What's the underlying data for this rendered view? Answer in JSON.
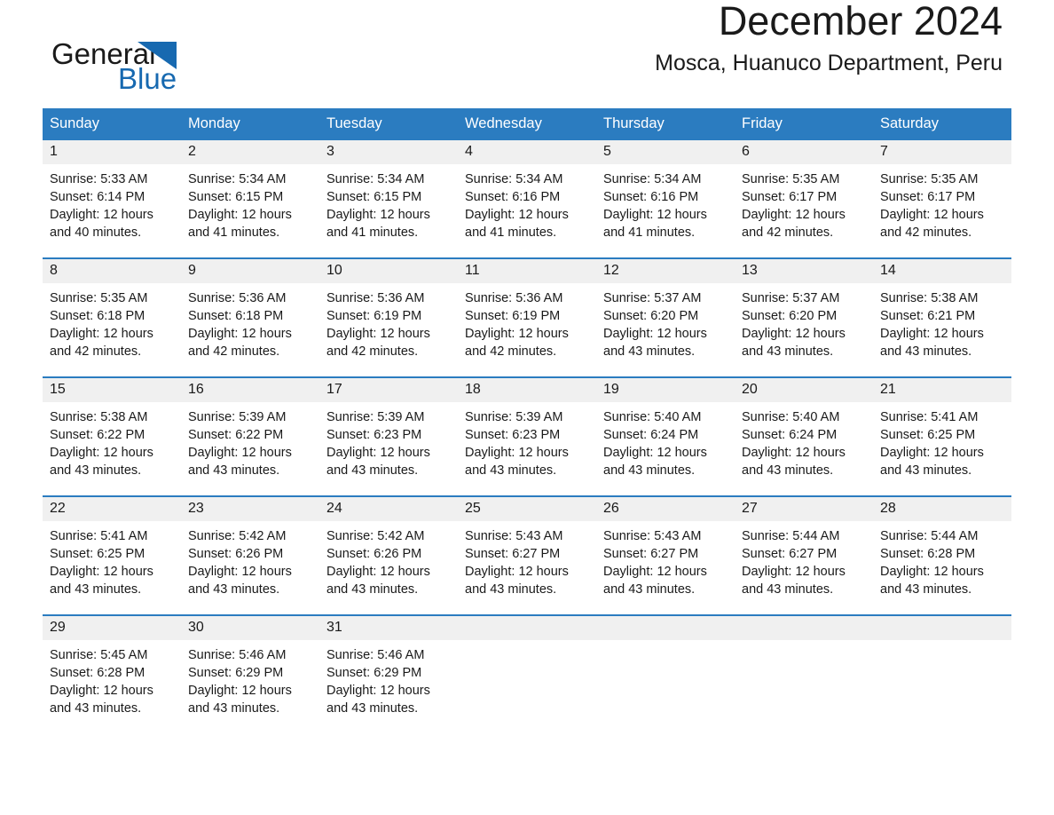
{
  "brand": {
    "name_part1": "General",
    "name_part2": "Blue",
    "triangle_icon": "triangle-logo-icon",
    "accent_color": "#1769b0"
  },
  "header": {
    "title": "December 2024",
    "subtitle": "Mosca, Huanuco Department, Peru"
  },
  "theme": {
    "header_blue": "#2b7cc0",
    "daynum_band": "#f0f0f0",
    "text": "#1a1a1a"
  },
  "weekday_headers": [
    "Sunday",
    "Monday",
    "Tuesday",
    "Wednesday",
    "Thursday",
    "Friday",
    "Saturday"
  ],
  "weeks": [
    [
      {
        "day": "1",
        "sunrise": "Sunrise: 5:33 AM",
        "sunset": "Sunset: 6:14 PM",
        "daylight_line1": "Daylight: 12 hours",
        "daylight_line2": "and 40 minutes."
      },
      {
        "day": "2",
        "sunrise": "Sunrise: 5:34 AM",
        "sunset": "Sunset: 6:15 PM",
        "daylight_line1": "Daylight: 12 hours",
        "daylight_line2": "and 41 minutes."
      },
      {
        "day": "3",
        "sunrise": "Sunrise: 5:34 AM",
        "sunset": "Sunset: 6:15 PM",
        "daylight_line1": "Daylight: 12 hours",
        "daylight_line2": "and 41 minutes."
      },
      {
        "day": "4",
        "sunrise": "Sunrise: 5:34 AM",
        "sunset": "Sunset: 6:16 PM",
        "daylight_line1": "Daylight: 12 hours",
        "daylight_line2": "and 41 minutes."
      },
      {
        "day": "5",
        "sunrise": "Sunrise: 5:34 AM",
        "sunset": "Sunset: 6:16 PM",
        "daylight_line1": "Daylight: 12 hours",
        "daylight_line2": "and 41 minutes."
      },
      {
        "day": "6",
        "sunrise": "Sunrise: 5:35 AM",
        "sunset": "Sunset: 6:17 PM",
        "daylight_line1": "Daylight: 12 hours",
        "daylight_line2": "and 42 minutes."
      },
      {
        "day": "7",
        "sunrise": "Sunrise: 5:35 AM",
        "sunset": "Sunset: 6:17 PM",
        "daylight_line1": "Daylight: 12 hours",
        "daylight_line2": "and 42 minutes."
      }
    ],
    [
      {
        "day": "8",
        "sunrise": "Sunrise: 5:35 AM",
        "sunset": "Sunset: 6:18 PM",
        "daylight_line1": "Daylight: 12 hours",
        "daylight_line2": "and 42 minutes."
      },
      {
        "day": "9",
        "sunrise": "Sunrise: 5:36 AM",
        "sunset": "Sunset: 6:18 PM",
        "daylight_line1": "Daylight: 12 hours",
        "daylight_line2": "and 42 minutes."
      },
      {
        "day": "10",
        "sunrise": "Sunrise: 5:36 AM",
        "sunset": "Sunset: 6:19 PM",
        "daylight_line1": "Daylight: 12 hours",
        "daylight_line2": "and 42 minutes."
      },
      {
        "day": "11",
        "sunrise": "Sunrise: 5:36 AM",
        "sunset": "Sunset: 6:19 PM",
        "daylight_line1": "Daylight: 12 hours",
        "daylight_line2": "and 42 minutes."
      },
      {
        "day": "12",
        "sunrise": "Sunrise: 5:37 AM",
        "sunset": "Sunset: 6:20 PM",
        "daylight_line1": "Daylight: 12 hours",
        "daylight_line2": "and 43 minutes."
      },
      {
        "day": "13",
        "sunrise": "Sunrise: 5:37 AM",
        "sunset": "Sunset: 6:20 PM",
        "daylight_line1": "Daylight: 12 hours",
        "daylight_line2": "and 43 minutes."
      },
      {
        "day": "14",
        "sunrise": "Sunrise: 5:38 AM",
        "sunset": "Sunset: 6:21 PM",
        "daylight_line1": "Daylight: 12 hours",
        "daylight_line2": "and 43 minutes."
      }
    ],
    [
      {
        "day": "15",
        "sunrise": "Sunrise: 5:38 AM",
        "sunset": "Sunset: 6:22 PM",
        "daylight_line1": "Daylight: 12 hours",
        "daylight_line2": "and 43 minutes."
      },
      {
        "day": "16",
        "sunrise": "Sunrise: 5:39 AM",
        "sunset": "Sunset: 6:22 PM",
        "daylight_line1": "Daylight: 12 hours",
        "daylight_line2": "and 43 minutes."
      },
      {
        "day": "17",
        "sunrise": "Sunrise: 5:39 AM",
        "sunset": "Sunset: 6:23 PM",
        "daylight_line1": "Daylight: 12 hours",
        "daylight_line2": "and 43 minutes."
      },
      {
        "day": "18",
        "sunrise": "Sunrise: 5:39 AM",
        "sunset": "Sunset: 6:23 PM",
        "daylight_line1": "Daylight: 12 hours",
        "daylight_line2": "and 43 minutes."
      },
      {
        "day": "19",
        "sunrise": "Sunrise: 5:40 AM",
        "sunset": "Sunset: 6:24 PM",
        "daylight_line1": "Daylight: 12 hours",
        "daylight_line2": "and 43 minutes."
      },
      {
        "day": "20",
        "sunrise": "Sunrise: 5:40 AM",
        "sunset": "Sunset: 6:24 PM",
        "daylight_line1": "Daylight: 12 hours",
        "daylight_line2": "and 43 minutes."
      },
      {
        "day": "21",
        "sunrise": "Sunrise: 5:41 AM",
        "sunset": "Sunset: 6:25 PM",
        "daylight_line1": "Daylight: 12 hours",
        "daylight_line2": "and 43 minutes."
      }
    ],
    [
      {
        "day": "22",
        "sunrise": "Sunrise: 5:41 AM",
        "sunset": "Sunset: 6:25 PM",
        "daylight_line1": "Daylight: 12 hours",
        "daylight_line2": "and 43 minutes."
      },
      {
        "day": "23",
        "sunrise": "Sunrise: 5:42 AM",
        "sunset": "Sunset: 6:26 PM",
        "daylight_line1": "Daylight: 12 hours",
        "daylight_line2": "and 43 minutes."
      },
      {
        "day": "24",
        "sunrise": "Sunrise: 5:42 AM",
        "sunset": "Sunset: 6:26 PM",
        "daylight_line1": "Daylight: 12 hours",
        "daylight_line2": "and 43 minutes."
      },
      {
        "day": "25",
        "sunrise": "Sunrise: 5:43 AM",
        "sunset": "Sunset: 6:27 PM",
        "daylight_line1": "Daylight: 12 hours",
        "daylight_line2": "and 43 minutes."
      },
      {
        "day": "26",
        "sunrise": "Sunrise: 5:43 AM",
        "sunset": "Sunset: 6:27 PM",
        "daylight_line1": "Daylight: 12 hours",
        "daylight_line2": "and 43 minutes."
      },
      {
        "day": "27",
        "sunrise": "Sunrise: 5:44 AM",
        "sunset": "Sunset: 6:27 PM",
        "daylight_line1": "Daylight: 12 hours",
        "daylight_line2": "and 43 minutes."
      },
      {
        "day": "28",
        "sunrise": "Sunrise: 5:44 AM",
        "sunset": "Sunset: 6:28 PM",
        "daylight_line1": "Daylight: 12 hours",
        "daylight_line2": "and 43 minutes."
      }
    ],
    [
      {
        "day": "29",
        "sunrise": "Sunrise: 5:45 AM",
        "sunset": "Sunset: 6:28 PM",
        "daylight_line1": "Daylight: 12 hours",
        "daylight_line2": "and 43 minutes."
      },
      {
        "day": "30",
        "sunrise": "Sunrise: 5:46 AM",
        "sunset": "Sunset: 6:29 PM",
        "daylight_line1": "Daylight: 12 hours",
        "daylight_line2": "and 43 minutes."
      },
      {
        "day": "31",
        "sunrise": "Sunrise: 5:46 AM",
        "sunset": "Sunset: 6:29 PM",
        "daylight_line1": "Daylight: 12 hours",
        "daylight_line2": "and 43 minutes."
      },
      {
        "day": "",
        "sunrise": "",
        "sunset": "",
        "daylight_line1": "",
        "daylight_line2": ""
      },
      {
        "day": "",
        "sunrise": "",
        "sunset": "",
        "daylight_line1": "",
        "daylight_line2": ""
      },
      {
        "day": "",
        "sunrise": "",
        "sunset": "",
        "daylight_line1": "",
        "daylight_line2": ""
      },
      {
        "day": "",
        "sunrise": "",
        "sunset": "",
        "daylight_line1": "",
        "daylight_line2": ""
      }
    ]
  ]
}
